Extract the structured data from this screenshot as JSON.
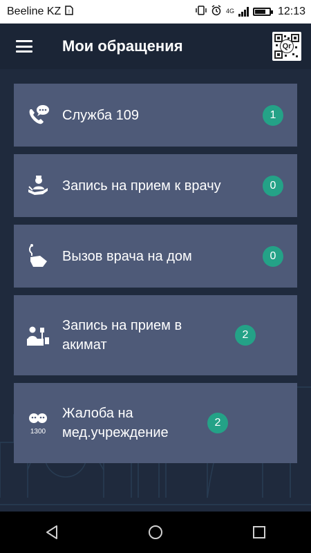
{
  "status_bar": {
    "carrier": "Beeline KZ",
    "network": "4G",
    "time": "12:13",
    "icons": [
      "sim-warning-icon",
      "vibrate-icon",
      "alarm-icon",
      "signal-icon",
      "battery-icon"
    ]
  },
  "app_bar": {
    "title": "Мои обращения",
    "menu_icon": "hamburger-menu-icon",
    "qr_icon": "qr-code-icon",
    "qr_label": "Qr"
  },
  "items": [
    {
      "label": "Служба 109",
      "count": "1",
      "icon": "phone-chat-icon"
    },
    {
      "label": "Запись на прием к врачу",
      "count": "0",
      "icon": "doctor-appointment-icon"
    },
    {
      "label": "Вызов врача на дом",
      "count": "0",
      "icon": "stethoscope-house-icon"
    },
    {
      "label": "Запись на прием в акимат",
      "count": "2",
      "icon": "official-desk-icon"
    },
    {
      "label": "Жалоба на мед.учреждение",
      "count": "2",
      "icon": "complaint-1300-icon",
      "icon_text": "1300"
    }
  ],
  "nav": [
    "back-icon",
    "home-icon",
    "recents-icon"
  ],
  "colors": {
    "background": "#1f2a3d",
    "card": "#4e5a78",
    "badge": "#24a287",
    "appbar": "#1b2536"
  }
}
